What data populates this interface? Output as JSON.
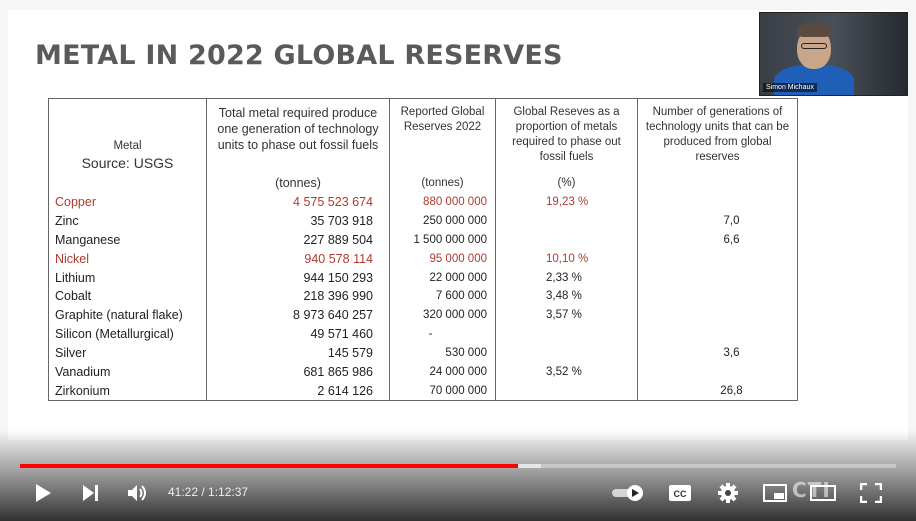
{
  "slide": {
    "title": "METAL IN 2022 GLOBAL RESERVES"
  },
  "webcam": {
    "name": "Simon Michaux"
  },
  "table": {
    "headers": {
      "metal": "Metal",
      "source": "Source: USGS",
      "required": "Total metal required produce one generation of technology units to phase out fossil fuels",
      "required_unit": "(tonnes)",
      "reserves": "Reported Global Reserves 2022",
      "reserves_unit": "(tonnes)",
      "proportion": "Global Reseves as a proportion of metals required to phase out fossil fuels",
      "proportion_unit": "(%)",
      "generations": "Number of generations of technology units that can be produced from global reserves"
    },
    "rows": [
      {
        "name": "Copper",
        "required": "4 575 523 674",
        "reserves": "880 000 000",
        "proportion": "19,23 %",
        "generations": ""
      },
      {
        "name": "Zinc",
        "required": "35 703 918",
        "reserves": "250 000 000",
        "proportion": "",
        "generations": "7,0"
      },
      {
        "name": "Manganese",
        "required": "227 889 504",
        "reserves": "1 500 000 000",
        "proportion": "",
        "generations": "6,6"
      },
      {
        "name": "Nickel",
        "required": "940 578 114",
        "reserves": "95 000 000",
        "proportion": "10,10 %",
        "generations": ""
      },
      {
        "name": "Lithium",
        "required": "944 150 293",
        "reserves": "22 000 000",
        "proportion": "2,33 %",
        "generations": ""
      },
      {
        "name": "Cobalt",
        "required": "218 396 990",
        "reserves": "7 600 000",
        "proportion": "3,48 %",
        "generations": ""
      },
      {
        "name": "Graphite (natural flake)",
        "required": "8 973 640 257",
        "reserves": "320 000 000",
        "proportion": "3,57 %",
        "generations": ""
      },
      {
        "name": "Silicon (Metallurgical)",
        "required": "49 571 460",
        "reserves": "-",
        "proportion": "",
        "generations": ""
      },
      {
        "name": "Silver",
        "required": "145 579",
        "reserves": "530 000",
        "proportion": "",
        "generations": "3,6"
      },
      {
        "name": "Vanadium",
        "required": "681 865 986",
        "reserves": "24 000 000",
        "proportion": "3,52 %",
        "generations": ""
      },
      {
        "name": "Zirkonium",
        "required": "2 614 126",
        "reserves": "70 000 000",
        "proportion": "",
        "generations": "26,8"
      }
    ]
  },
  "player": {
    "current_time": "41:22",
    "separator": " / ",
    "duration": "1:12:37",
    "progress_fraction": 0.569,
    "buffer_fraction": 0.595,
    "accent_color": "#ff0000",
    "highlight_color": "#b03a2e",
    "controls": [
      "play-icon",
      "next-icon",
      "volume-icon",
      "autoplay-toggle",
      "subtitles-icon",
      "settings-gear-icon",
      "miniplayer-icon",
      "theater-mode-icon",
      "fullscreen-icon"
    ],
    "watermark": "CTI"
  }
}
